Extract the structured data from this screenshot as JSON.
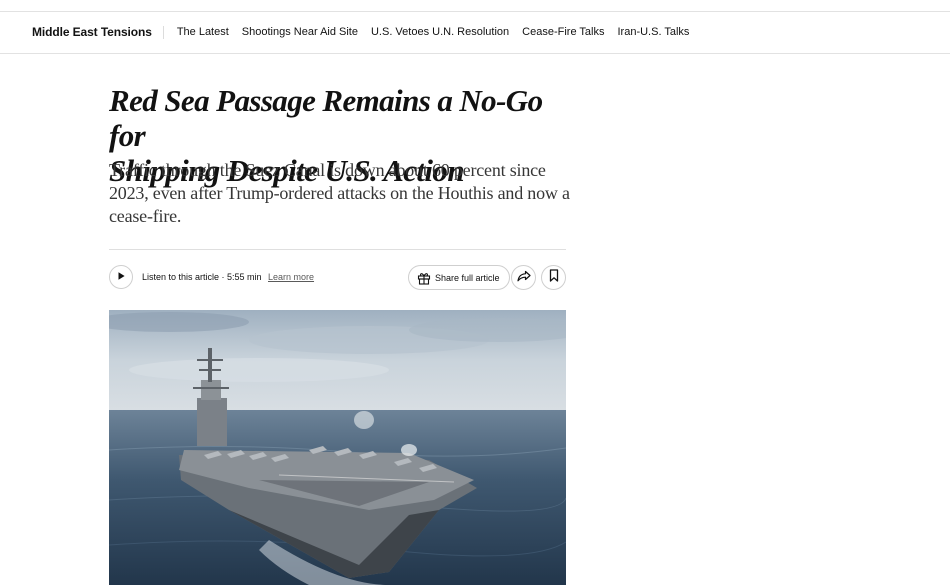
{
  "subnav": {
    "title": "Middle East Tensions",
    "links": [
      {
        "label": "The Latest"
      },
      {
        "label": "Shootings Near Aid Site"
      },
      {
        "label": "U.S. Vetoes U.N. Resolution"
      },
      {
        "label": "Cease-Fire Talks"
      },
      {
        "label": "Iran-U.S. Talks"
      }
    ]
  },
  "article": {
    "headline_line1": "Red Sea Passage Remains a No-Go for",
    "headline_line2": "Shipping Despite U.S. Action",
    "summary": "Traffic through the Suez Canal is down about 60 percent since 2023, even after Trump-ordered attacks on the Houthis and now a cease-fire."
  },
  "toolbar": {
    "listen_label": "Listen to this article · 5:55 min",
    "learn_more": "Learn more",
    "share_full_article": "Share full article"
  },
  "icons": {
    "play": "play-icon",
    "gift": "gift-icon",
    "share": "share-arrow-icon",
    "save": "bookmark-icon"
  },
  "colors": {
    "text": "#121212",
    "summary_text": "#363636",
    "divider": "#e2e2e2"
  }
}
